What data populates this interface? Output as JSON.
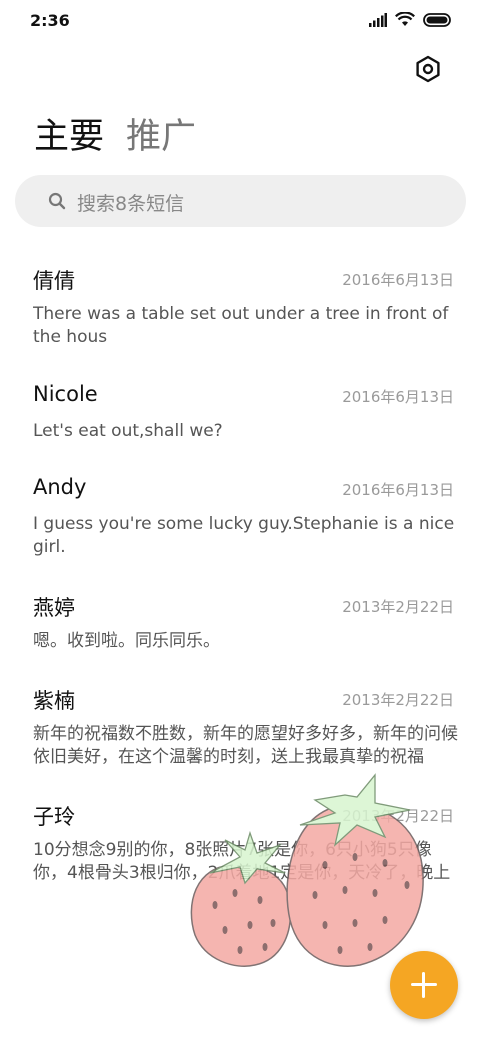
{
  "status_bar": {
    "time": "2:36"
  },
  "tabs": [
    {
      "label": "主要",
      "active": true
    },
    {
      "label": "推广",
      "active": false
    }
  ],
  "search": {
    "placeholder": "搜索8条短信"
  },
  "messages": [
    {
      "name": "倩倩",
      "date": "2016年6月13日",
      "preview": "There was a table set out under a tree in front of the hous"
    },
    {
      "name": "Nicole",
      "date": "2016年6月13日",
      "preview": "Let's eat out,shall we?"
    },
    {
      "name": "Andy",
      "date": "2016年6月13日",
      "preview": "I guess you're some lucky guy.Stephanie is a nice girl."
    },
    {
      "name": "燕婷",
      "date": "2013年2月22日",
      "preview": "嗯。收到啦。同乐同乐。"
    },
    {
      "name": "紫楠",
      "date": "2013年2月22日",
      "preview": "新年的祝福数不胜数，新年的愿望好多好多，新年的问候依旧美好，在这个温馨的时刻，送上我最真挚的祝福"
    },
    {
      "name": "子玲",
      "date": "2013年2月22日",
      "preview": "10分想念9别的你，8张照片7张是你，6只小狗5只像你，4根骨头3根归你，2爪着地1定是你，天冷了，晚上"
    }
  ],
  "colors": {
    "fab": "#f5a623",
    "search_bg": "#efefef",
    "strawberry": "#f4a9a3",
    "leaf": "#d8f5d0"
  },
  "icons": {
    "settings": "settings-icon",
    "search": "search-icon",
    "compose": "plus-icon"
  }
}
